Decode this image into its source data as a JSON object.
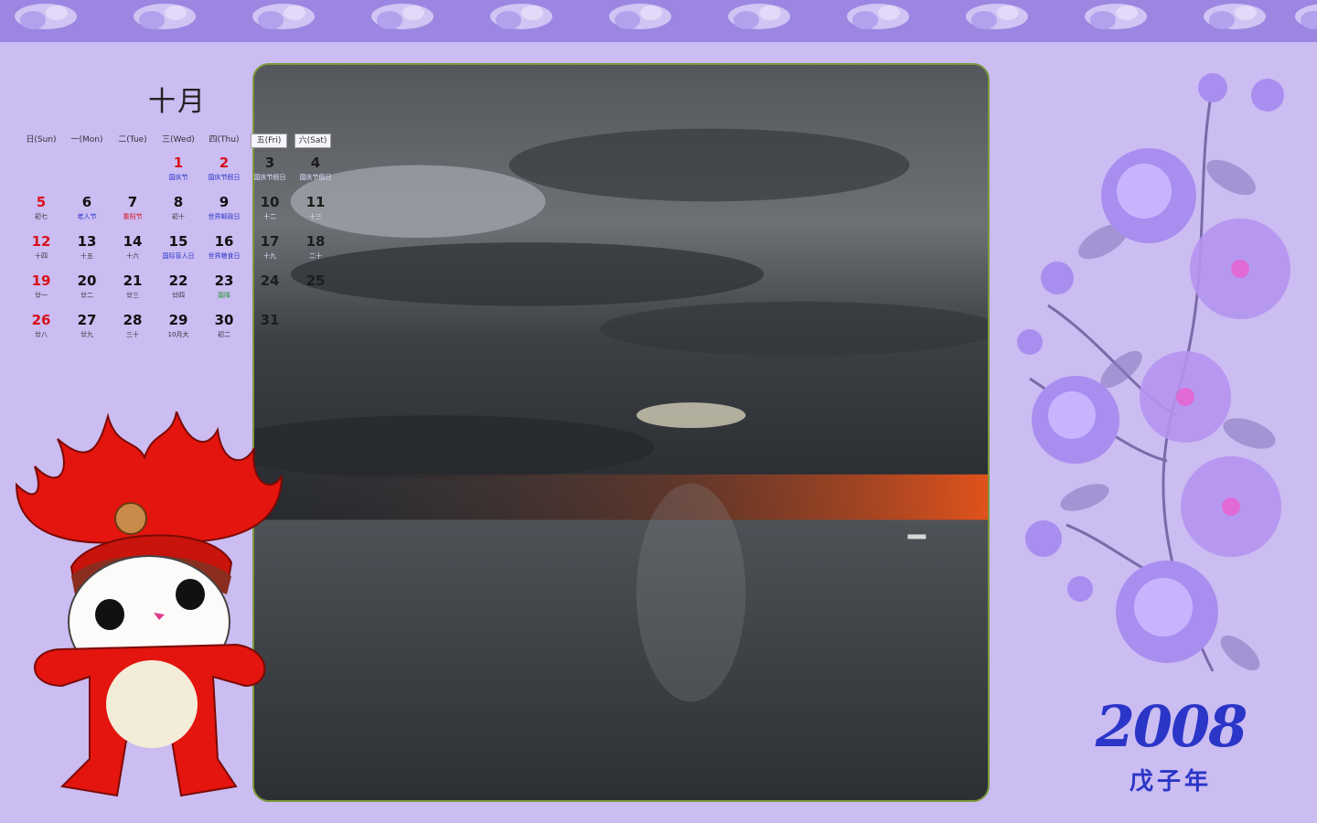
{
  "calendar": {
    "month_title": "十月",
    "weekdays": [
      "日(Sun)",
      "一(Mon)",
      "二(Tue)",
      "三(Wed)",
      "四(Thu)",
      "五(Fri)",
      "六(Sat)"
    ],
    "weeks": [
      [
        {
          "d": "",
          "l": ""
        },
        {
          "d": "",
          "l": ""
        },
        {
          "d": "",
          "l": ""
        },
        {
          "d": "1",
          "l": "国庆节",
          "dc": "red",
          "lc": "blue"
        },
        {
          "d": "2",
          "l": "国庆节假日",
          "dc": "red",
          "lc": "blue"
        },
        {
          "d": "3",
          "l": "国庆节假日",
          "dc": "red",
          "lc": "blue",
          "over": true
        },
        {
          "d": "4",
          "l": "国庆节假日",
          "dc": "green",
          "lc": "blue",
          "over": true
        }
      ],
      [
        {
          "d": "5",
          "l": "初七",
          "dc": "red"
        },
        {
          "d": "6",
          "l": "老人节",
          "lc": "blue"
        },
        {
          "d": "7",
          "l": "重阳节",
          "lc": "red"
        },
        {
          "d": "8",
          "l": "初十"
        },
        {
          "d": "9",
          "l": "世界邮政日",
          "lc": "blue"
        },
        {
          "d": "10",
          "l": "十二",
          "over": true
        },
        {
          "d": "11",
          "l": "十三",
          "dc": "red",
          "over": true
        }
      ],
      [
        {
          "d": "12",
          "l": "十四",
          "dc": "red"
        },
        {
          "d": "13",
          "l": "十五"
        },
        {
          "d": "14",
          "l": "十六"
        },
        {
          "d": "15",
          "l": "国际盲人日",
          "lc": "blue"
        },
        {
          "d": "16",
          "l": "世界粮食日",
          "lc": "blue"
        },
        {
          "d": "17",
          "l": "十九",
          "over": true
        },
        {
          "d": "18",
          "l": "二十",
          "dc": "green",
          "over": true
        }
      ],
      [
        {
          "d": "19",
          "l": "廿一",
          "dc": "red"
        },
        {
          "d": "20",
          "l": "廿二"
        },
        {
          "d": "21",
          "l": "廿三"
        },
        {
          "d": "22",
          "l": "廿四"
        },
        {
          "d": "23",
          "l": "霜降",
          "lc": "green"
        },
        {
          "d": "24",
          "l": "",
          "over": true
        },
        {
          "d": "25",
          "l": "",
          "dc": "red",
          "over": true
        }
      ],
      [
        {
          "d": "26",
          "l": "廿八",
          "dc": "red"
        },
        {
          "d": "27",
          "l": "廿九"
        },
        {
          "d": "28",
          "l": "三十"
        },
        {
          "d": "29",
          "l": "10月大"
        },
        {
          "d": "30",
          "l": "初二"
        },
        {
          "d": "31",
          "l": "",
          "over": true
        },
        {
          "d": "",
          "l": ""
        }
      ]
    ]
  },
  "year": {
    "number": "2008",
    "ganzhi": "戊子年"
  },
  "icons": {
    "mascot": "fuwa-huanhuan-mascot",
    "flowers": "purple-flower-bouquet",
    "photo": "stormy-sea-sunset-photo",
    "border": "floral-border-pattern"
  },
  "colors": {
    "background": "#cbbcf2",
    "border": "#9a84e0",
    "accent_blue": "#2b35c8",
    "holiday_red": "#d8101a",
    "saturday_green": "#1a8c2a"
  }
}
